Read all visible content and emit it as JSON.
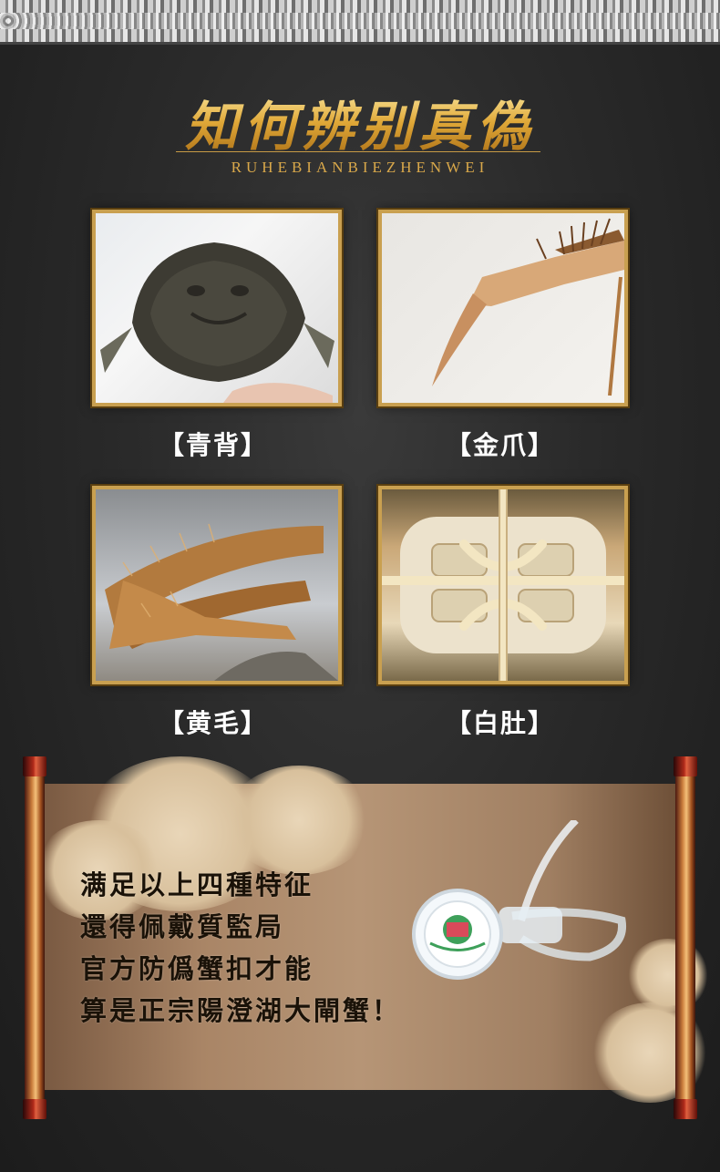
{
  "header": {
    "title": "知何辨别真偽",
    "subtitle": "RUHEBIANBIEZHENWEI"
  },
  "features": [
    {
      "label": "【青背】"
    },
    {
      "label": "【金爪】"
    },
    {
      "label": "【黄毛】"
    },
    {
      "label": "【白肚】"
    }
  ],
  "message": {
    "lines": [
      "满足以上四種特征",
      "還得佩戴質監局",
      "官方防僞蟹扣才能",
      "算是正宗陽澄湖大閘蟹！"
    ]
  },
  "colors": {
    "gold": "#e0a838",
    "frame": "#c9a050",
    "background": "#2a2a2a",
    "scroll": "#b69576"
  }
}
